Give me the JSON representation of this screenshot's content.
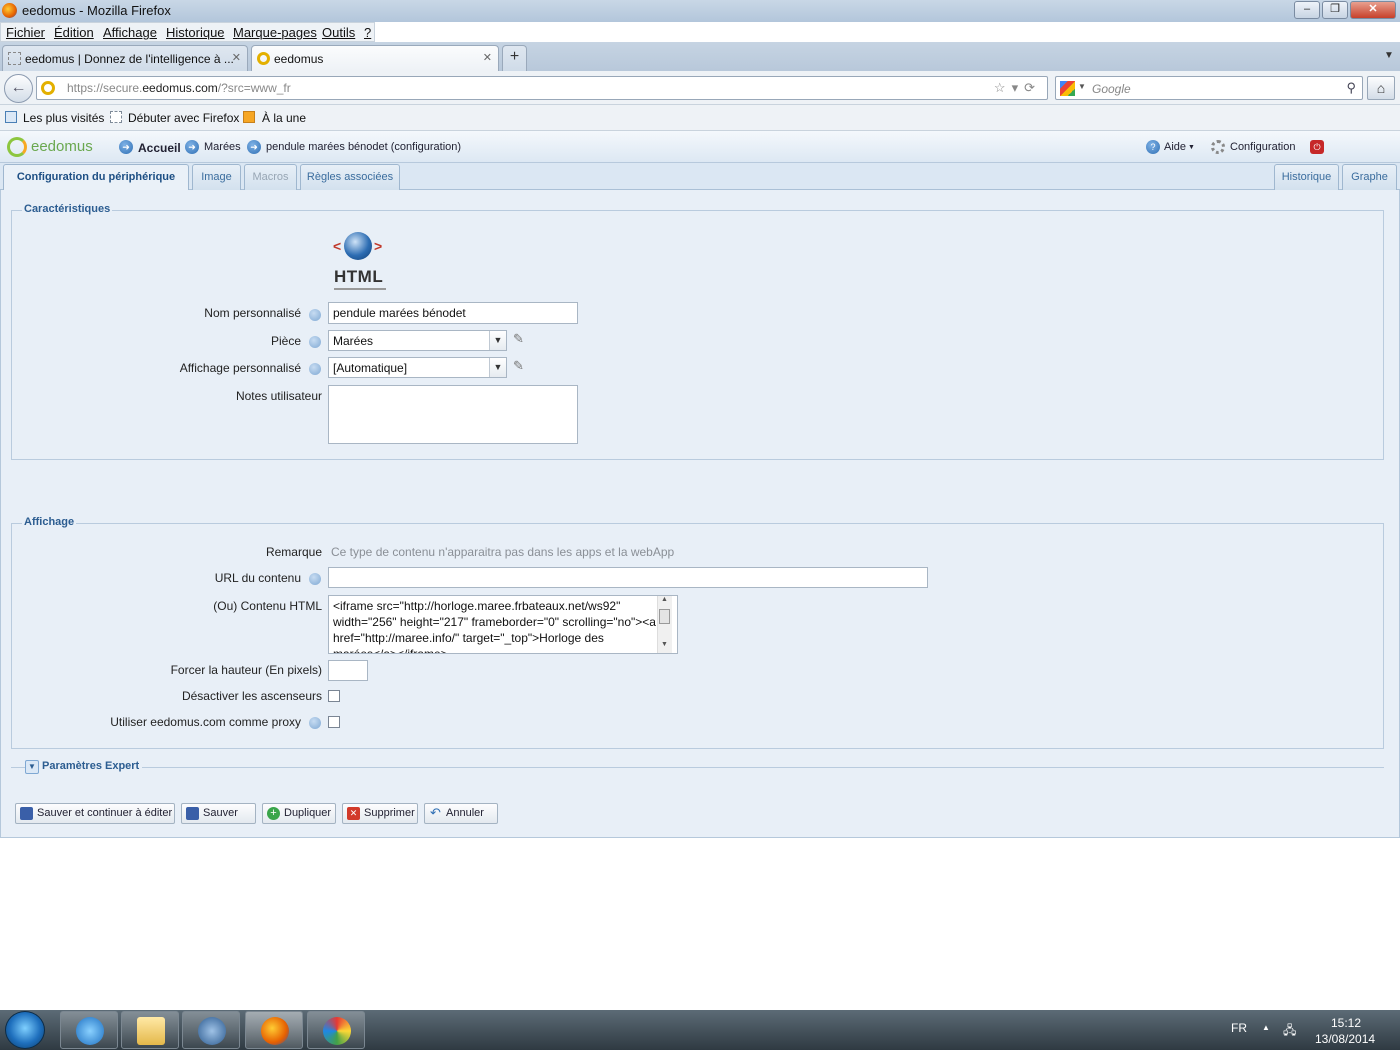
{
  "window": {
    "title": "eedomus - Mozilla Firefox"
  },
  "menu": [
    "Fichier",
    "Édition",
    "Affichage",
    "Historique",
    "Marque-pages",
    "Outils",
    "?"
  ],
  "browser_tabs": [
    {
      "label": "eedomus | Donnez de l'intelligence à ...",
      "active": false
    },
    {
      "label": "eedomus",
      "active": true
    }
  ],
  "url": {
    "prefix": "https://secure.",
    "host": "eedomus.com",
    "path": "/?src=www_fr"
  },
  "search": {
    "placeholder": "Google"
  },
  "bookmarks": [
    "Les plus visités",
    "Débuter avec Firefox",
    "À la une"
  ],
  "app": {
    "logo": "eedomus",
    "breadcrumb": [
      "Accueil",
      "Marées",
      "pendule marées bénodet (configuration)"
    ],
    "right": {
      "help": "Aide",
      "config": "Configuration"
    },
    "tabs_left": [
      {
        "label": "Configuration du périphérique",
        "state": "active"
      },
      {
        "label": "Image",
        "state": "normal"
      },
      {
        "label": "Macros",
        "state": "disabled"
      },
      {
        "label": "Règles associées",
        "state": "normal"
      }
    ],
    "tabs_right": [
      "Historique",
      "Graphe"
    ]
  },
  "caracteristiques": {
    "legend": "Caractéristiques",
    "logo_text": "HTML",
    "nom_label": "Nom personnalisé",
    "nom_value": "pendule marées bénodet",
    "piece_label": "Pièce",
    "piece_value": "Marées",
    "affichage_label": "Affichage personnalisé",
    "affichage_value": "[Automatique]",
    "notes_label": "Notes utilisateur",
    "notes_value": ""
  },
  "affichage": {
    "legend": "Affichage",
    "remarque_label": "Remarque",
    "remarque_text": "Ce type de contenu n'apparaitra pas dans les apps et la webApp",
    "url_label": "URL du contenu",
    "url_value": "",
    "html_label": "(Ou) Contenu HTML",
    "html_value": "<iframe src=\"http://horloge.maree.frbateaux.net/ws92\" width=\"256\" height=\"217\" frameborder=\"0\" scrolling=\"no\"><a href=\"http://maree.info/\" target=\"_top\">Horloge des marées</a></iframe>",
    "hauteur_label": "Forcer la hauteur (En pixels)",
    "hauteur_value": "",
    "ascenseurs_label": "Désactiver les ascenseurs",
    "proxy_label": "Utiliser eedomus.com comme proxy"
  },
  "expert": {
    "label": "Paramètres Expert"
  },
  "buttons": {
    "save_continue": "Sauver et continuer à éditer",
    "save": "Sauver",
    "duplicate": "Dupliquer",
    "delete": "Supprimer",
    "cancel": "Annuler"
  },
  "tray": {
    "lang": "FR",
    "time": "15:12",
    "date": "13/08/2014"
  }
}
